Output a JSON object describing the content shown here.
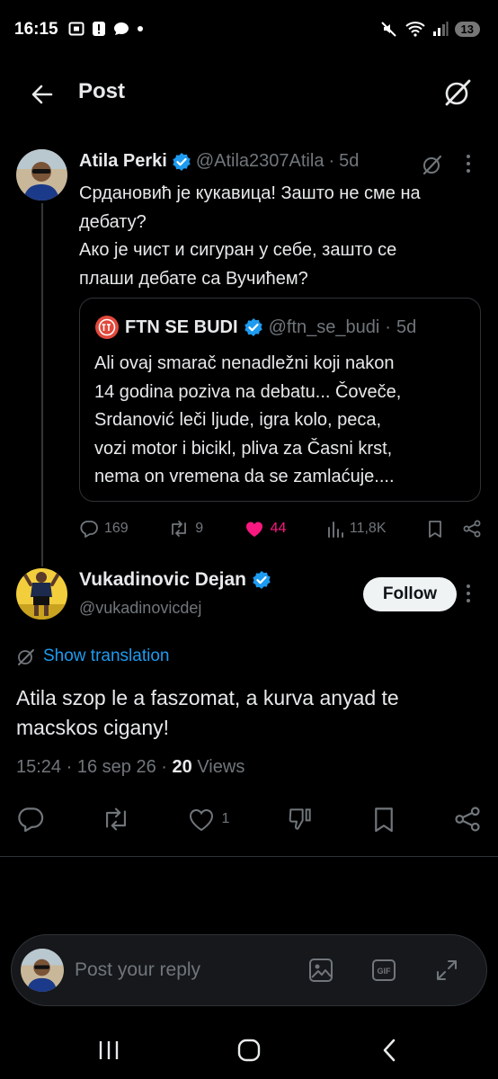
{
  "status_bar": {
    "time": "16:15",
    "battery": "13"
  },
  "header": {
    "title": "Post"
  },
  "tweet1": {
    "name": "Atila Perki",
    "handle": "@Atila2307Atila",
    "dot": "·",
    "age": "5d",
    "lines": [
      "Срдановић је кукавица! Зашто не сме на",
      "дебату?",
      "Ако је чист и сигуран у себе, зашто се",
      "плаши дебате са Вучићем?"
    ],
    "quote": {
      "name": "FTN SE BUDI",
      "handle": "@ftn_se_budi",
      "dot": "·",
      "age": "5d",
      "lines": [
        "Ali ovaj smarač nenadležni koji nakon",
        "14 godina poziva na debatu... Čoveče,",
        "Srdanović leči ljude, igra kolo, peca,",
        "vozi motor i bicikl, pliva za Časni krst,",
        "nema on vremena da se zamlaćuje...."
      ]
    },
    "stats": {
      "replies": "169",
      "reposts": "9",
      "likes": "44",
      "views": "11,8K"
    }
  },
  "tweet2": {
    "name": "Vukadinovic Dejan",
    "handle": "@vukadinovicdej",
    "follow_label": "Follow",
    "show_translation": "Show translation",
    "lines": [
      "Atila szop le a faszomat, a kurva anyad te",
      "macskos cigany!"
    ],
    "meta": {
      "time": "15:24",
      "sep": "·",
      "date": "16 sep 26",
      "views_count": "20",
      "views_label": "Views"
    },
    "likes": "1"
  },
  "reply": {
    "placeholder": "Post your reply"
  },
  "colors": {
    "accent": "#1d9bf0",
    "like": "#f91880",
    "muted": "#71767b",
    "text": "#e7e9ea",
    "background": "#000000"
  },
  "icons": [
    "back-arrow-icon",
    "grok-icon",
    "verified-badge-icon",
    "reply-icon",
    "repost-icon",
    "heart-icon",
    "views-icon",
    "bookmark-icon",
    "share-icon",
    "translate-icon",
    "image-icon",
    "gif-icon",
    "expand-icon"
  ]
}
